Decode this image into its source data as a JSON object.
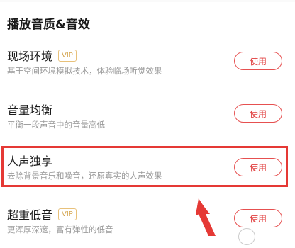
{
  "section": {
    "title": "播放音质&音效"
  },
  "items": [
    {
      "title": "现场环境",
      "vip": "VIP",
      "desc": "基于空间环境模拟技术，体验临场听觉效果",
      "button": "使用"
    },
    {
      "title": "音量均衡",
      "vip": "",
      "desc": "平衡一段声音中的音量高低",
      "button": "使用"
    },
    {
      "title": "人声独享",
      "vip": "",
      "desc": "去除背景音乐和噪音，还原真实的人声效果",
      "button": "使用"
    },
    {
      "title": "超重低音",
      "vip": "VIP",
      "desc": "更浑厚深邃，富有弹性的低音",
      "button": "使用"
    }
  ],
  "colors": {
    "accent": "#e03c3c",
    "highlight": "#e53935",
    "vip": "#d4a54f"
  }
}
